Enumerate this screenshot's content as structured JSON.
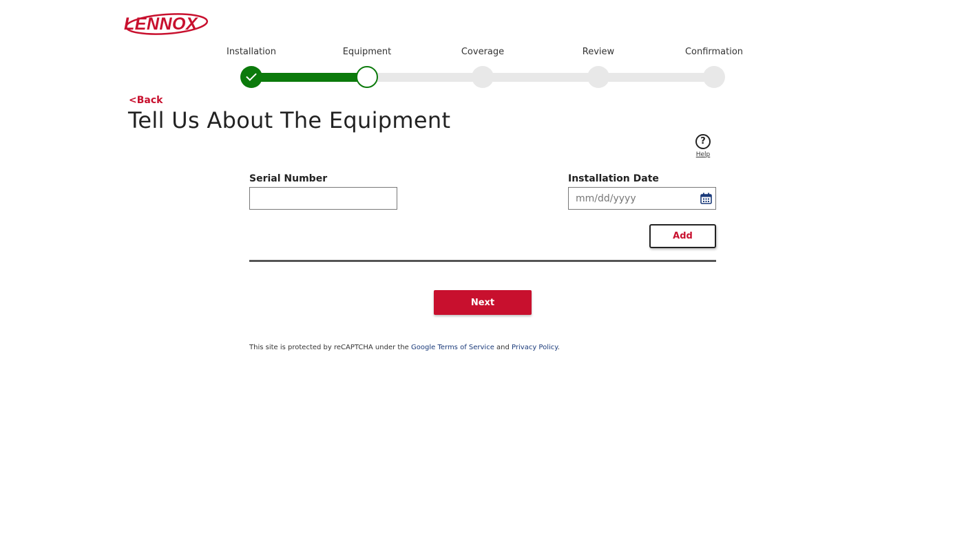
{
  "brand": {
    "logo_text": "LENNOX",
    "accent_color": "#c8102e",
    "progress_color": "#0b7a0b"
  },
  "stepper": {
    "steps": [
      {
        "label": "Installation",
        "status": "complete"
      },
      {
        "label": "Equipment",
        "status": "current"
      },
      {
        "label": "Coverage",
        "status": "upcoming"
      },
      {
        "label": "Review",
        "status": "upcoming"
      },
      {
        "label": "Confirmation",
        "status": "upcoming"
      }
    ]
  },
  "nav": {
    "back_label": "<Back"
  },
  "page": {
    "title": "Tell Us About The Equipment"
  },
  "help": {
    "icon": "question-circle-icon",
    "icon_glyph": "?",
    "label": "Help"
  },
  "form": {
    "serial_number": {
      "label": "Serial Number",
      "value": "",
      "placeholder": ""
    },
    "installation_date": {
      "label": "Installation Date",
      "value": "",
      "placeholder": "mm/dd/yyyy",
      "icon": "calendar-icon"
    },
    "add_label": "Add",
    "next_label": "Next"
  },
  "footer": {
    "recaptcha_prefix": "This site is protected by reCAPTCHA under the ",
    "terms_link": "Google Terms of Service",
    "conjunction": " and ",
    "privacy_link": "Privacy Policy",
    "suffix": "."
  }
}
